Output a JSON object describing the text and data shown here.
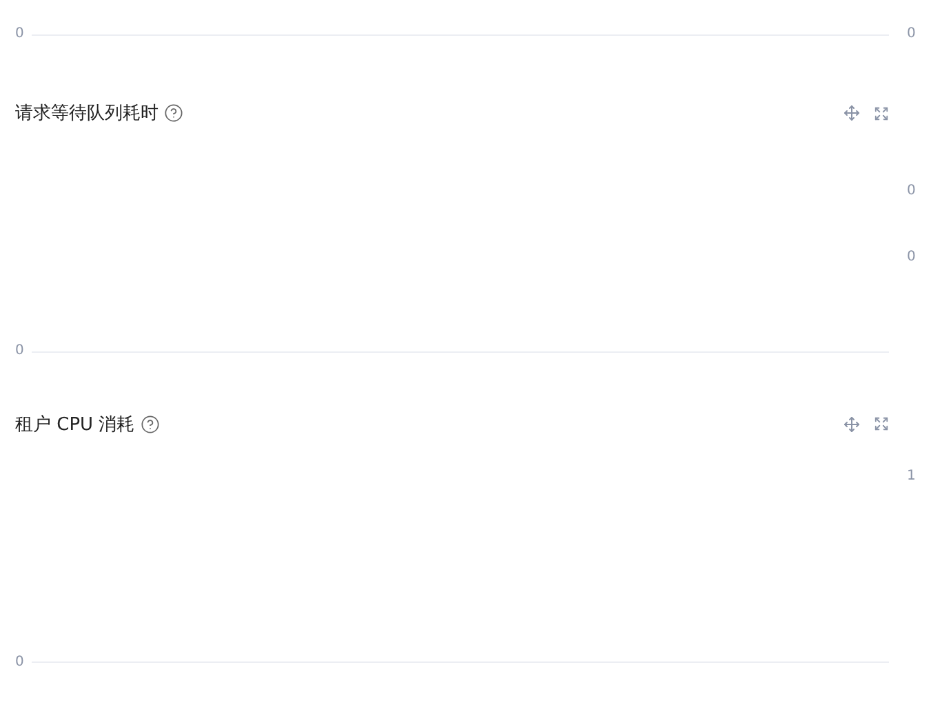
{
  "top_chart": {
    "y_axis_label": "0"
  },
  "panels": [
    {
      "title": "请求等待队列耗时",
      "y_axis_label": "0"
    },
    {
      "title": "租户 CPU 消耗",
      "y_axis_label": "0"
    }
  ],
  "right_column": {
    "y_axis_labels": [
      "0",
      "0",
      "0",
      "1"
    ]
  }
}
